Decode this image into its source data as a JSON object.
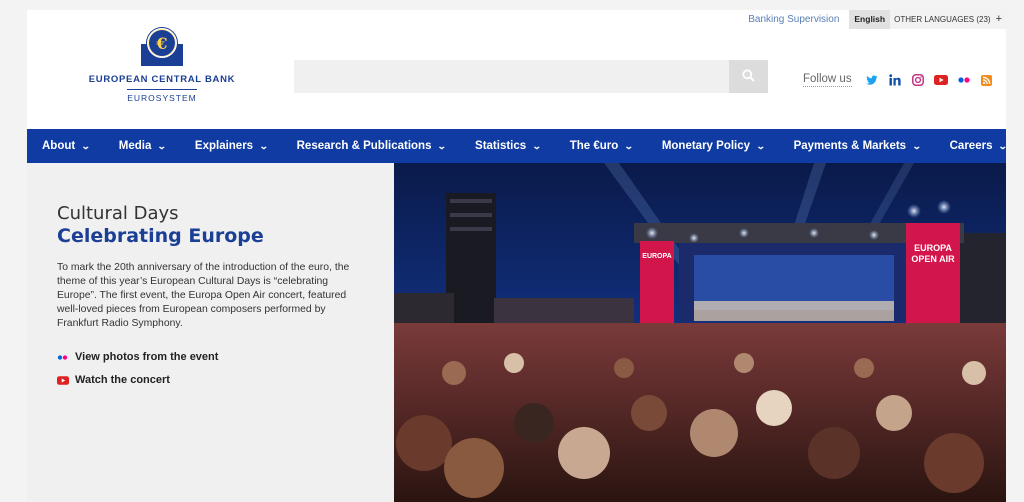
{
  "brand": {
    "name": "EUROPEAN CENTRAL BANK",
    "sub": "EUROSYSTEM",
    "symbol": "€",
    "color": "#1b3f94"
  },
  "top_links": {
    "supervision": "Banking Supervision",
    "language_current": "English",
    "language_other": "OTHER LANGUAGES (23)",
    "language_plus": "+"
  },
  "search": {
    "placeholder": "",
    "icon": "search-icon"
  },
  "follow": {
    "label": "Follow us",
    "icons": [
      "twitter-icon",
      "linkedin-icon",
      "instagram-icon",
      "youtube-icon",
      "flickr-icon",
      "rss-icon"
    ]
  },
  "nav": {
    "color": "#0f3ba2",
    "items": [
      {
        "label": "About"
      },
      {
        "label": "Media"
      },
      {
        "label": "Explainers"
      },
      {
        "label": "Research & Publications"
      },
      {
        "label": "Statistics"
      },
      {
        "label": "The €uro"
      },
      {
        "label": "Monetary Policy"
      },
      {
        "label": "Payments & Markets"
      },
      {
        "label": "Careers"
      }
    ]
  },
  "hero": {
    "kicker": "Cultural Days",
    "title": "Celebrating Europe",
    "body": "To mark the 20th anniversary of the introduction of the euro, the theme of this year’s European Cultural Days is “celebrating Europe”. The first event, the Europa Open Air concert, featured well-loved pieces from European composers performed by Frankfurt Radio Symphony.",
    "links": [
      {
        "label": "View photos from the event",
        "icon": "flickr-icon"
      },
      {
        "label": "Watch the concert",
        "icon": "youtube-icon"
      }
    ],
    "image": {
      "banner_text_line1": "EUROPA",
      "banner_text_line2": "OPEN AIR"
    }
  }
}
